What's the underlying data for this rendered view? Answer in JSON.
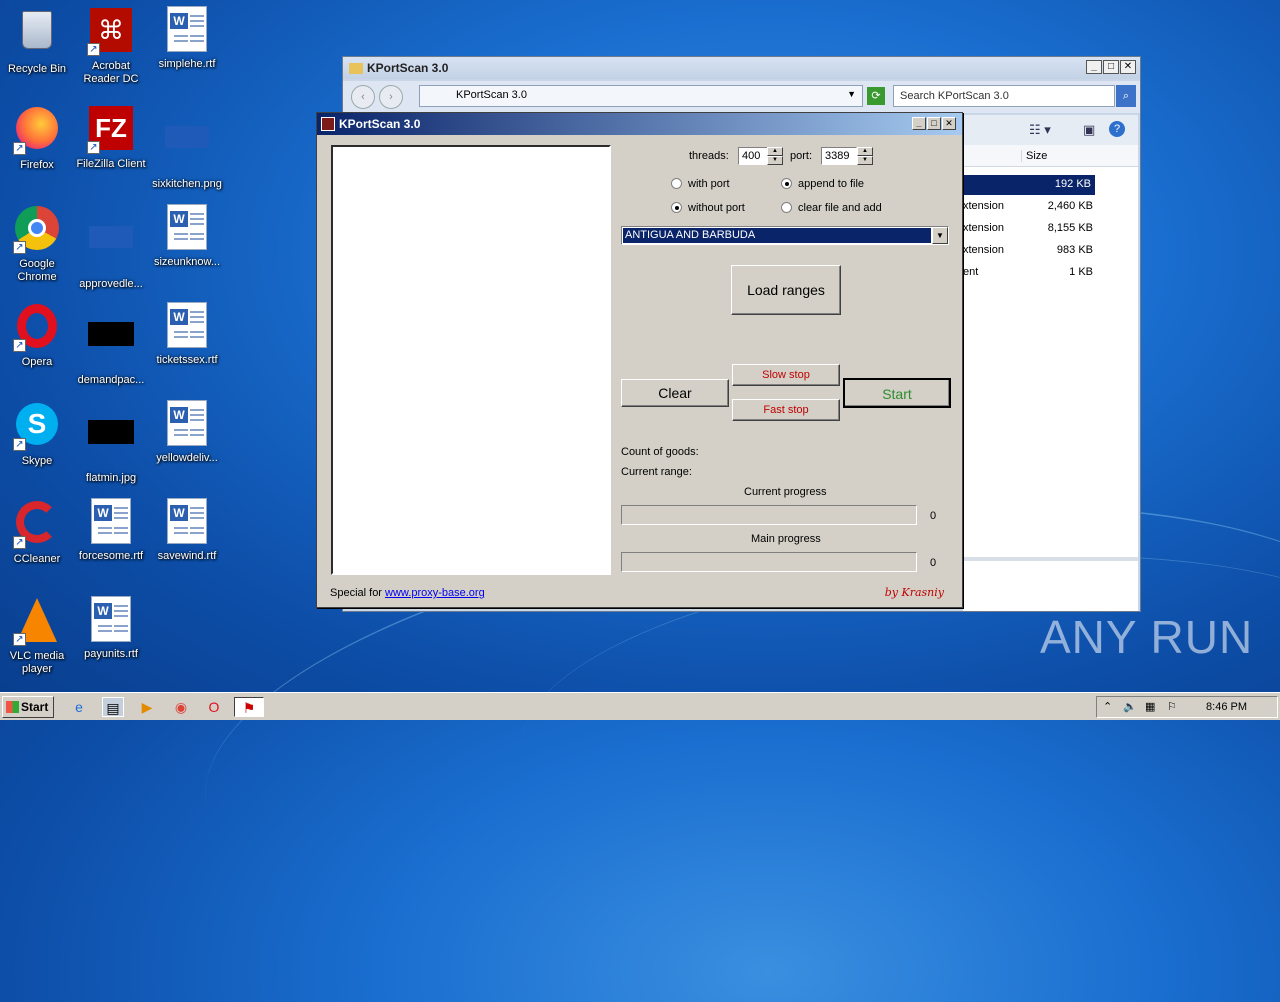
{
  "desktop": {
    "icons": [
      {
        "label": "Recycle Bin"
      },
      {
        "label": "Acrobat Reader DC"
      },
      {
        "label": "simplehe.rtf"
      },
      {
        "label": "Firefox"
      },
      {
        "label": "FileZilla Client"
      },
      {
        "label": "sixkitchen.png"
      },
      {
        "label": "Google Chrome"
      },
      {
        "label": "approvedle..."
      },
      {
        "label": "sizeunknow..."
      },
      {
        "label": "Opera"
      },
      {
        "label": "demandpac..."
      },
      {
        "label": "ticketssex.rtf"
      },
      {
        "label": "Skype"
      },
      {
        "label": "flatmin.jpg"
      },
      {
        "label": "yellowdeliv..."
      },
      {
        "label": "CCleaner"
      },
      {
        "label": "forcesome.rtf"
      },
      {
        "label": "savewind.rtf"
      },
      {
        "label": "VLC media player"
      },
      {
        "label": "payunits.rtf"
      }
    ]
  },
  "explorer": {
    "title": "KPortScan 3.0",
    "address": "KPortScan 3.0",
    "search_placeholder": "Search KPortScan 3.0",
    "column_size": "Size",
    "rows": [
      {
        "type": "",
        "size": "192 KB"
      },
      {
        "type": "xtension",
        "size": "2,460 KB"
      },
      {
        "type": "xtension",
        "size": "8,155 KB"
      },
      {
        "type": "xtension",
        "size": "983 KB"
      },
      {
        "type": "ent",
        "size": "1 KB"
      }
    ]
  },
  "kps": {
    "title": "KPortScan 3.0",
    "threads_label": "threads:",
    "threads_value": "400",
    "port_label": "port:",
    "port_value": "3389",
    "with_port": "with port",
    "without_port": "without port",
    "append_to_file": "append to file",
    "clear_file_and_add": "clear file and add",
    "country": "ANTIGUA AND BARBUDA",
    "load_ranges": "Load ranges",
    "clear": "Clear",
    "slow_stop": "Slow stop",
    "fast_stop": "Fast stop",
    "start": "Start",
    "count_of_goods": "Count of goods:",
    "current_range": "Current range:",
    "current_progress": "Current progress",
    "current_progress_value": "0",
    "main_progress": "Main progress",
    "main_progress_value": "0",
    "special_for": "Special for",
    "link": "www.proxy-base.org",
    "by": "by Krasniy"
  },
  "taskbar": {
    "start": "Start",
    "clock": "8:46 PM"
  },
  "watermark": "ANY RUN"
}
